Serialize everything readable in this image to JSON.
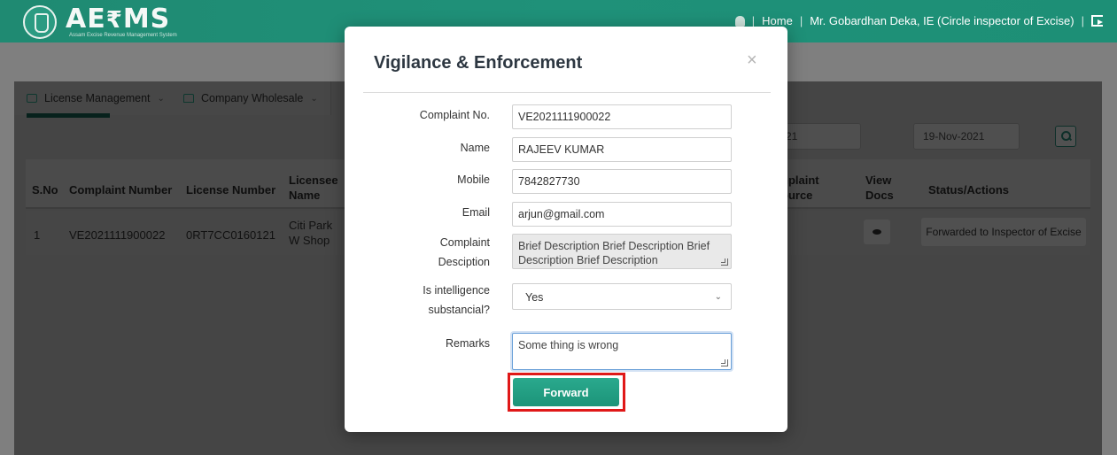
{
  "header": {
    "logo_text": "AERMS",
    "logo_subtitle": "Assam Excise Revenue Management System",
    "home_link": "Home",
    "user_name": "Mr. Gobardhan Deka, IE (Circle inspector of Excise)"
  },
  "menu": {
    "items": [
      {
        "label": "License Management",
        "icon": "id-card-icon"
      },
      {
        "label": "Company Wholesale",
        "icon": "building-icon"
      }
    ]
  },
  "filters": {
    "from_date_partial": "21",
    "to_date": "19-Nov-2021"
  },
  "table": {
    "headers": [
      "S.No",
      "Complaint Number",
      "License Number",
      "Licensee Name",
      "nplaint ource",
      "View Docs",
      "Status/Actions"
    ],
    "rows": [
      {
        "sno": "1",
        "complaint_number": "VE2021111900022",
        "license_number": "0RT7CC0160121",
        "licensee_name": "Citi Park W Shop",
        "status": "Forwarded to Inspector of Excise"
      }
    ]
  },
  "modal": {
    "title": "Vigilance & Enforcement",
    "close_symbol": "×",
    "fields": {
      "complaint_no": {
        "label": "Complaint No.",
        "value": "VE2021111900022"
      },
      "name": {
        "label": "Name",
        "value": "RAJEEV KUMAR"
      },
      "mobile": {
        "label": "Mobile",
        "value": "7842827730"
      },
      "email": {
        "label": "Email",
        "value": "arjun@gmail.com"
      },
      "description": {
        "label_line1": "Complaint",
        "label_line2": "Desciption",
        "value": "Brief Description Brief Description Brief Description Brief Description"
      },
      "intelligence": {
        "label_line1": "Is intelligence",
        "label_line2": "substancial?",
        "value": "Yes"
      },
      "remarks": {
        "label": "Remarks",
        "value": "Some thing is wrong"
      }
    },
    "forward_label": "Forward"
  },
  "colors": {
    "header_bg": "#1f8a72",
    "accent": "#1c9479",
    "highlight_outline": "#e01818"
  }
}
